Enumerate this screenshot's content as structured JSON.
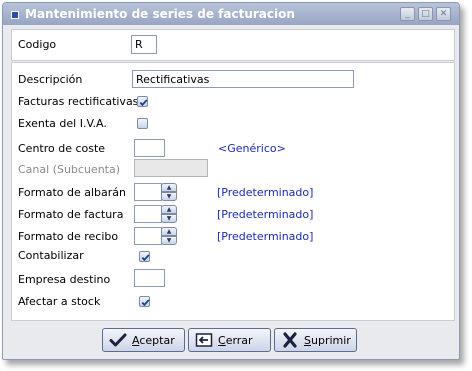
{
  "window": {
    "title": "Mantenimiento de series de facturacion"
  },
  "codigo": {
    "label": "Codigo",
    "value": "R"
  },
  "form": {
    "descripcion": {
      "label": "Descripción",
      "value": "Rectificativas"
    },
    "facturas_rectificativas": {
      "label": "Facturas rectificativas",
      "checked": true
    },
    "exenta_iva": {
      "label": "Exenta del I.V.A.",
      "checked": false
    },
    "centro_coste": {
      "label": "Centro de coste",
      "value": "",
      "link": "<Genérico>"
    },
    "canal": {
      "label": "Canal (Subcuenta)",
      "value": "",
      "disabled": true
    },
    "formato_albaran": {
      "label": "Formato de albarán",
      "link": "[Predeterminado]"
    },
    "formato_factura": {
      "label": "Formato de factura",
      "link": "[Predeterminado]"
    },
    "formato_recibo": {
      "label": "Formato de recibo",
      "link": "[Predeterminado]"
    },
    "contabilizar": {
      "label": "Contabilizar",
      "checked": true
    },
    "empresa_destino": {
      "label": "Empresa destino",
      "value": ""
    },
    "afectar_stock": {
      "label": "Afectar a stock",
      "checked": true
    }
  },
  "buttons": {
    "aceptar": {
      "first": "A",
      "rest": "ceptar",
      "icon": "check-icon"
    },
    "cerrar": {
      "first": "C",
      "rest": "errar",
      "icon": "back-arrow-icon"
    },
    "suprimir": {
      "first": "S",
      "rest": "uprimir",
      "icon": "delete-x-icon"
    }
  },
  "colors": {
    "link": "#1a2bb8",
    "titlebar": "#98a6c4",
    "check": "#1c3f8f"
  }
}
